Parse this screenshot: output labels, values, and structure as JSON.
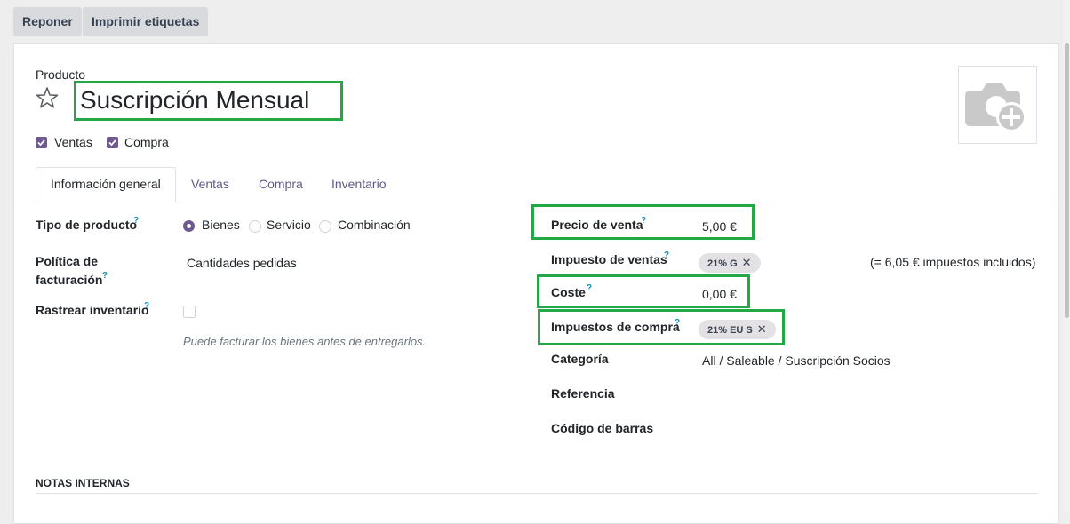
{
  "toolbar": {
    "replenish_label": "Reponer",
    "print_labels_label": "Imprimir etiquetas"
  },
  "product": {
    "label": "Producto",
    "name": "Suscripción Mensual",
    "can_be_sold_label": "Ventas",
    "can_be_purchased_label": "Compra",
    "can_be_sold": true,
    "can_be_purchased": true
  },
  "tabs": [
    {
      "label": "Información general",
      "active": true
    },
    {
      "label": "Ventas"
    },
    {
      "label": "Compra"
    },
    {
      "label": "Inventario"
    }
  ],
  "general": {
    "product_type_label": "Tipo de producto",
    "product_type_options": [
      "Bienes",
      "Servicio",
      "Combinación"
    ],
    "product_type_selected": "Bienes",
    "invoicing_policy_label_1": "Política de",
    "invoicing_policy_label_2": "facturación",
    "invoicing_policy_value": "Cantidades pedidas",
    "track_inventory_label": "Rastrear inventario",
    "hint": "Puede facturar los bienes antes de entregarlos.",
    "help_mark": "?"
  },
  "pricing": {
    "sale_price_label": "Precio de venta",
    "sale_price_value": "5,00 €",
    "sales_tax_label": "Impuesto de ventas",
    "sales_tax_tag": "21% G",
    "tax_included_note": "(= 6,05 € impuestos incluidos)",
    "cost_label": "Coste",
    "cost_value": "0,00 €",
    "purchase_tax_label": "Impuestos de compra",
    "purchase_tax_tag": "21% EU S",
    "category_label": "Categoría",
    "category_value": "All / Saleable / Suscripción Socios",
    "reference_label": "Referencia",
    "barcode_label": "Código de barras",
    "tag_remove": "✕"
  },
  "notes": {
    "heading": "NOTAS INTERNAS"
  },
  "colors": {
    "accent": "#6f5a8f",
    "highlight": "#22a844",
    "help": "#0d8fb3"
  }
}
